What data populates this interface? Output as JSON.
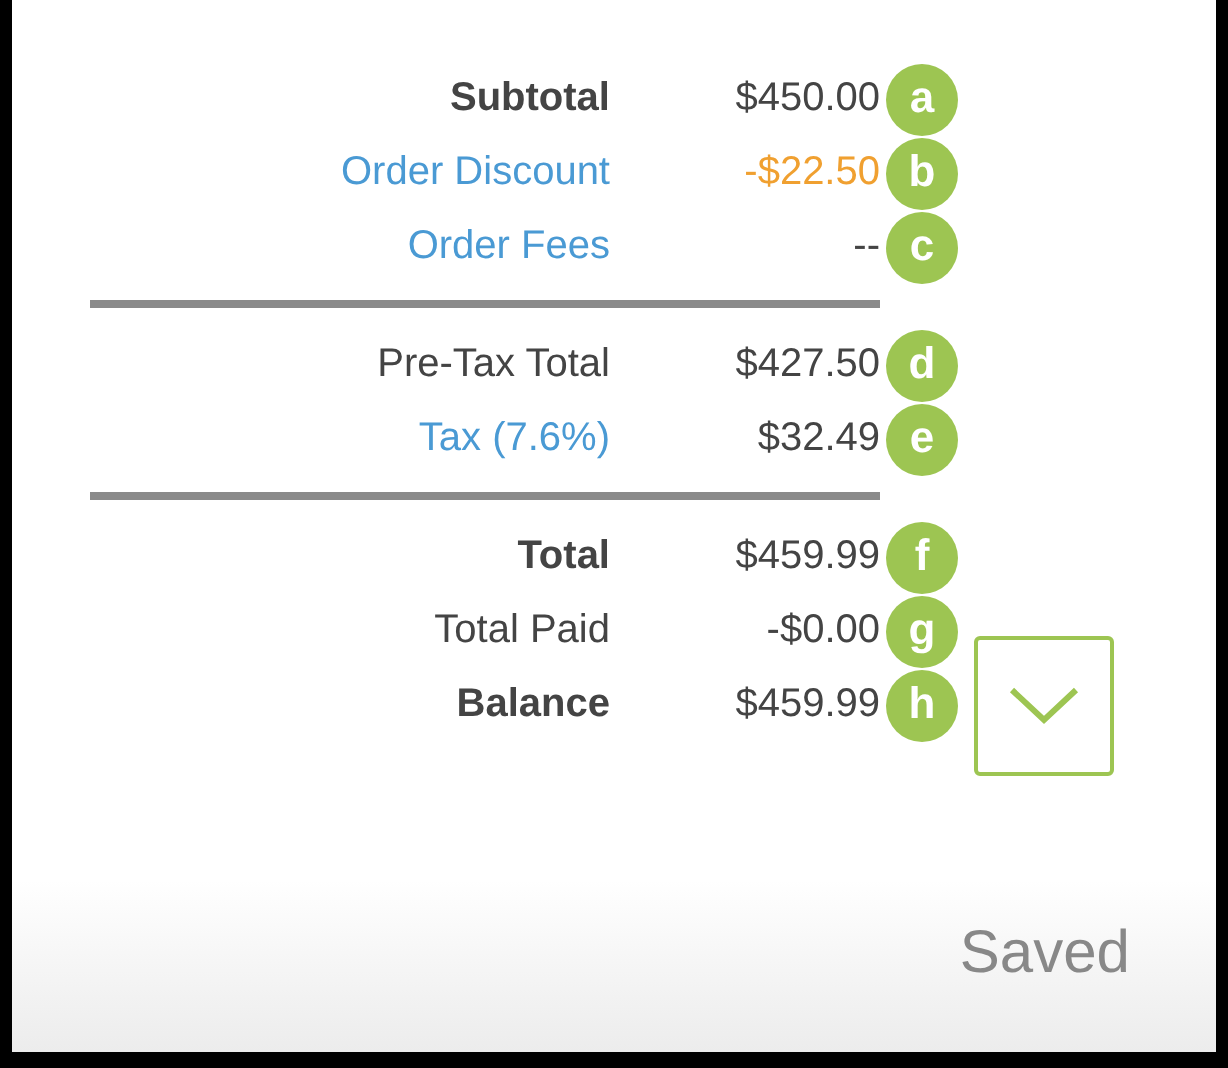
{
  "sections": [
    {
      "rows": [
        {
          "kind": "bold",
          "label": "Subtotal",
          "value": "$450.00",
          "marker": "a"
        },
        {
          "kind": "discount",
          "label": "Order Discount",
          "value": "-$22.50",
          "marker": "b"
        },
        {
          "kind": "link",
          "label": "Order Fees",
          "value": "--",
          "marker": "c"
        }
      ]
    },
    {
      "rows": [
        {
          "kind": "plain",
          "label": "Pre-Tax Total",
          "value": "$427.50",
          "marker": "d"
        },
        {
          "kind": "link",
          "label": "Tax (7.6%)",
          "value": "$32.49",
          "marker": "e"
        }
      ]
    },
    {
      "rows": [
        {
          "kind": "bold",
          "label": "Total",
          "value": "$459.99",
          "marker": "f"
        },
        {
          "kind": "plain",
          "label": "Total Paid",
          "value": "-$0.00",
          "marker": "g"
        },
        {
          "kind": "bold",
          "label": "Balance",
          "value": "$459.99",
          "marker": "h"
        }
      ]
    }
  ],
  "status": "Saved"
}
